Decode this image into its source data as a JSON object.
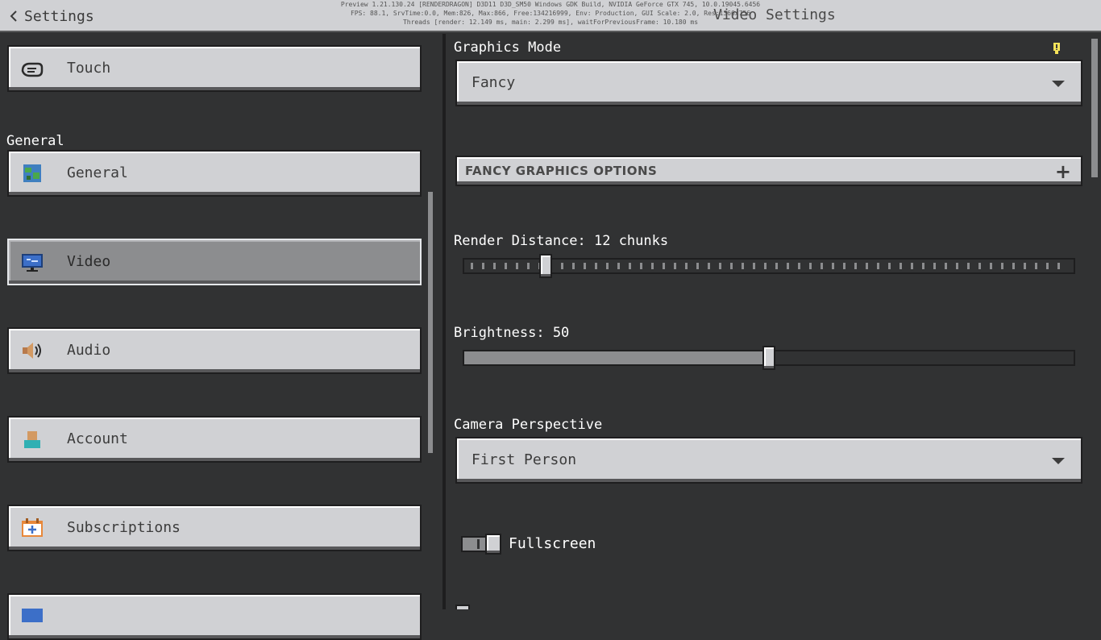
{
  "header": {
    "back_label": "Settings",
    "title": "Video Settings",
    "debug_lines": [
      "Preview 1.21.130.24 [RENDERDRAGON] D3D11 D3D_SM50 Windows GDK Build, NVIDIA GeForce GTX 745, 10.0.19045.6456",
      "FPS: 88.1, SrvTime:0.0, Mem:826, Max:866, Free:134216999, Env: Production, GUI Scale: 2.0, Res:1366x756",
      "Threads [render: 12.149 ms, main: 2.299 ms], waitForPreviousFrame: 10.180 ms"
    ]
  },
  "sidebar": {
    "section_general": "General",
    "items": [
      {
        "label": "Touch",
        "icon": "touch-icon"
      },
      {
        "label": "General",
        "icon": "globe-icon"
      },
      {
        "label": "Video",
        "icon": "monitor-icon",
        "selected": true
      },
      {
        "label": "Audio",
        "icon": "speaker-icon"
      },
      {
        "label": "Account",
        "icon": "account-icon"
      },
      {
        "label": "Subscriptions",
        "icon": "subscriptions-icon"
      }
    ]
  },
  "main": {
    "graphics_mode": {
      "label": "Graphics Mode",
      "value": "Fancy"
    },
    "fancy_options": {
      "label": "FANCY GRAPHICS OPTIONS",
      "expand_glyph": "+"
    },
    "render_distance": {
      "label": "Render Distance: 12 chunks",
      "fraction": 0.134
    },
    "brightness": {
      "label": "Brightness: 50",
      "fraction": 0.5
    },
    "camera_perspective": {
      "label": "Camera Perspective",
      "value": "First Person"
    },
    "fullscreen": {
      "label": "Fullscreen",
      "on": true
    }
  },
  "colors": {
    "background": "#313233",
    "button": "#d0d1d4",
    "button_selected": "#8c8d8f",
    "header": "#d0d1d4"
  }
}
